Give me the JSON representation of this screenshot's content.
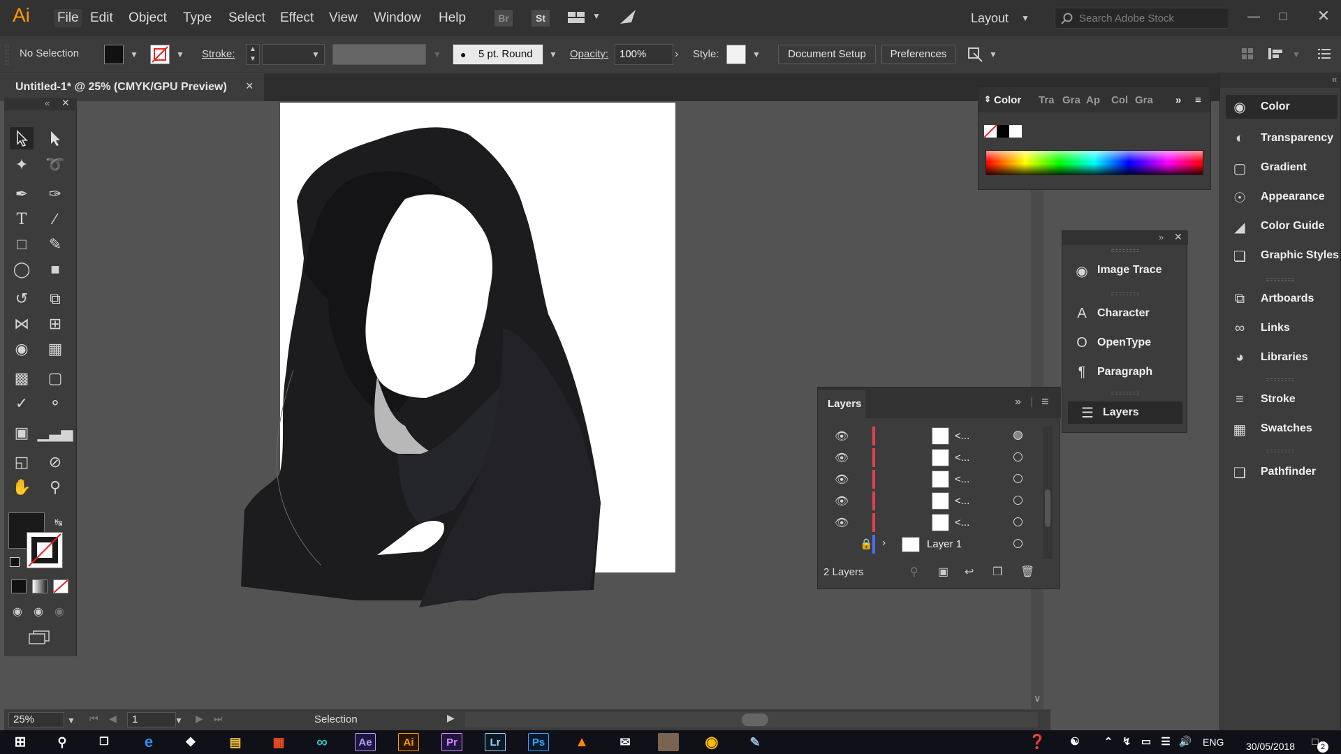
{
  "app": {
    "logo": "Ai"
  },
  "menu": [
    "File",
    "Edit",
    "Object",
    "Type",
    "Select",
    "Effect",
    "View",
    "Window",
    "Help"
  ],
  "bridge_buttons": [
    "Br",
    "St"
  ],
  "workspace": {
    "label": "Layout"
  },
  "search": {
    "placeholder": "Search Adobe Stock"
  },
  "control_bar": {
    "selection": "No Selection",
    "stroke_label": "Stroke:",
    "brush": "5 pt. Round",
    "opacity_label": "Opacity:",
    "opacity_value": "100%",
    "style_label": "Style:",
    "document_setup": "Document Setup",
    "preferences": "Preferences"
  },
  "document_tab": {
    "title": "Untitled-1* @ 25% (CMYK/GPU Preview)",
    "close": "×"
  },
  "color_panel": {
    "tabs": [
      "Color",
      "Tra",
      "Gra",
      "Ap",
      "Col",
      "Gra"
    ]
  },
  "middle_dock": [
    "Image Trace",
    "Character",
    "OpenType",
    "Paragraph",
    "Layers"
  ],
  "right_dock": [
    "Color",
    "Transparency",
    "Gradient",
    "Appearance",
    "Color Guide",
    "Graphic Styles",
    "Artboards",
    "Links",
    "Libraries",
    "Stroke",
    "Swatches",
    "Pathfinder"
  ],
  "layers_panel": {
    "title": "Layers",
    "rows": [
      "<...",
      "<...",
      "<...",
      "<...",
      "<..."
    ],
    "layer_name": "Layer 1",
    "footer": "2 Layers"
  },
  "status_bar": {
    "zoom": "25%",
    "artboard": "1",
    "tool": "Selection"
  },
  "taskbar": {
    "apps": [
      "Ae",
      "Ai",
      "Pr",
      "Lr",
      "Ps"
    ],
    "lang": "ENG",
    "date": "30/05/2018",
    "notifications": "2"
  },
  "colors": {
    "fill": "#1a1a1a",
    "accent": "#ff9a00"
  }
}
